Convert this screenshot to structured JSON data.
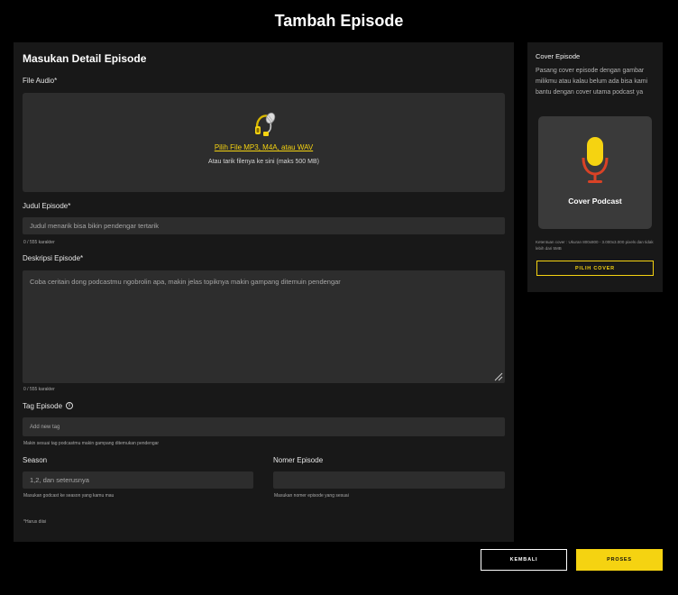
{
  "page": {
    "title": "Tambah Episode"
  },
  "details": {
    "section_title": "Masukan Detail Episode",
    "audio": {
      "label": "File Audio*",
      "link": "Pilih File MP3, M4A, atau WAV",
      "sub": "Atau tarik filenya ke sini (maks 500 MB)",
      "icon": "headphones-mic-icon"
    },
    "judul": {
      "label": "Judul Episode*",
      "placeholder": "Judul menarik bisa bikin pendengar tertarik",
      "counter": "0 / 555 karakter"
    },
    "deskripsi": {
      "label": "Deskripsi Episode*",
      "placeholder": "Coba ceritain dong podcastmu ngobrolin apa, makin jelas topiknya makin gampang ditemuin pendengar",
      "counter": "0 / 555 karakter"
    },
    "tag": {
      "label": "Tag Episode",
      "info": "i",
      "placeholder": "Add new tag",
      "hint": "Makin sesuai tag podcastmu makin gampang ditemukan pendengar"
    },
    "season": {
      "label": "Season",
      "placeholder": "1,2, dan seterusnya",
      "hint": "Masukan godcast ke season yang kamu mau"
    },
    "nomor": {
      "label": "Nomer Episode",
      "placeholder": "",
      "hint": "Masukan nomer episode yang sesuai"
    },
    "required_note": "*Harus diisi"
  },
  "cover": {
    "title": "Cover Episode",
    "desc": "Pasang cover episode dengan gambar milikmu atau kalau belum ada bisa kami bantu dengan cover utama podcast ya",
    "box_label": "Cover Podcast",
    "note": "Ketentuan cover : Ukuran 800x800 - 3.000x3.000 pixels dan tidak lebih dari 5MB",
    "button": "PILIH COVER"
  },
  "actions": {
    "back": "KEMBALI",
    "process": "PROSES"
  },
  "colors": {
    "accent": "#f5d311",
    "panel": "#181818",
    "field": "#2d2d2d",
    "mic_red": "#d94226"
  }
}
